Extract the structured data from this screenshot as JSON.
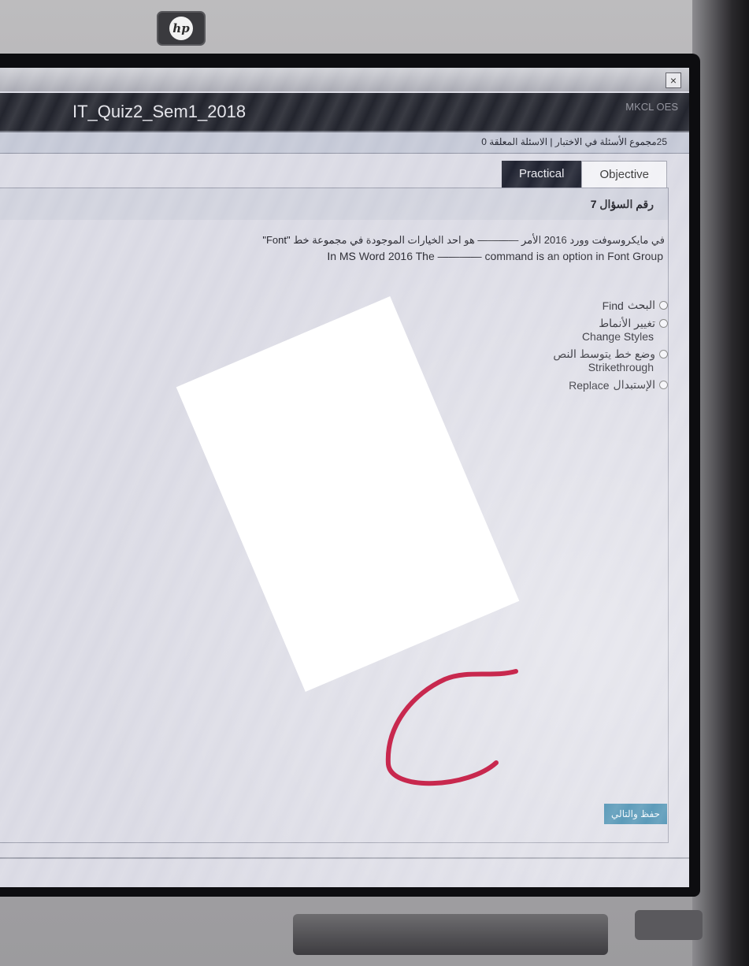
{
  "window": {
    "close_symbol": "×"
  },
  "header": {
    "quiz_title": "IT_Quiz2_Sem1_2018",
    "brand": "MKCL OES"
  },
  "status": {
    "text": "25مجموع الأسئلة في الاختبار | الاسئلة المعلقة 0"
  },
  "tabs": [
    {
      "label": "Practical",
      "active": false
    },
    {
      "label": "Objective",
      "active": true
    }
  ],
  "question": {
    "number_label": "رقم السؤال 7",
    "text_ar": "في مايكروسوفت وورد 2016 الأمر ———— هو احد الخيارات الموجودة في مجموعة خط \"Font\"",
    "text_en": "In MS Word 2016 The ———— command is an option in Font Group",
    "options": [
      {
        "ar": "البحث",
        "en": "Find",
        "layout": "inline"
      },
      {
        "ar": "تغيير الأنماط",
        "en": "Change Styles",
        "layout": "stacked"
      },
      {
        "ar": "وضع خط يتوسط النص",
        "en": "Strikethrough",
        "layout": "stacked"
      },
      {
        "ar": "الإستبدال",
        "en": "Replace",
        "layout": "inline"
      }
    ]
  },
  "footer": {
    "next_button": "حفظ والتالي"
  },
  "bezel": {
    "logo_text": "hp"
  },
  "colors": {
    "header_bg": "#23252e",
    "next_button": "#2f7fa6",
    "pen_mark": "#c8284e"
  }
}
